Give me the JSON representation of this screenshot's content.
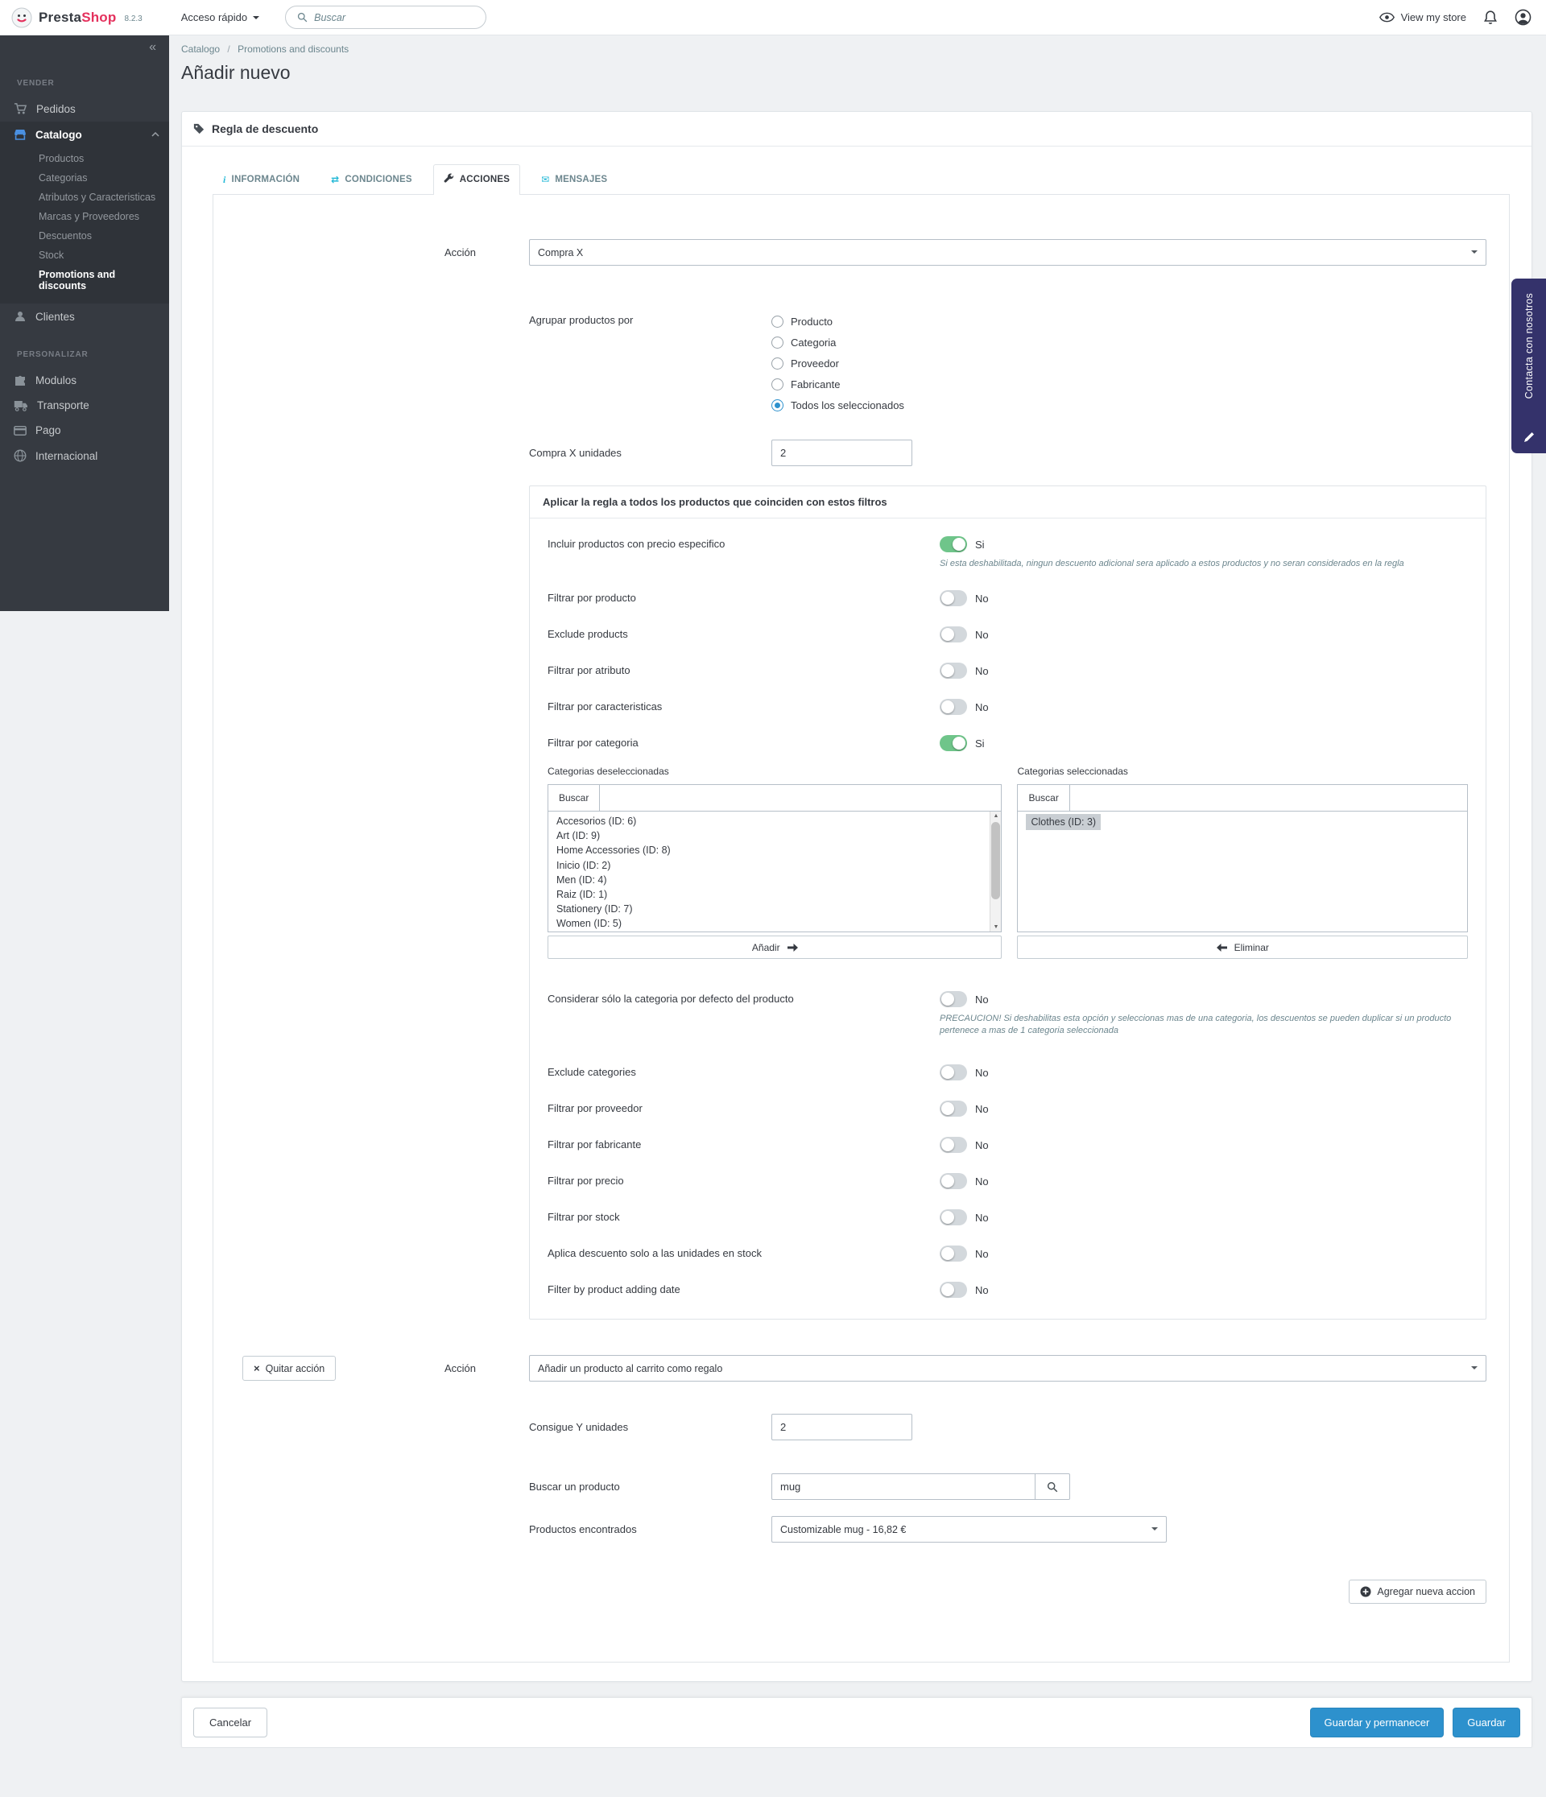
{
  "colors": {
    "accent": "#2d91cd",
    "toggle_on": "#6fc58a",
    "sidebar_bg": "#363a41",
    "brand_red": "#e4315d",
    "contact_bg": "#34326b",
    "tab_icon": "#25b9d7"
  },
  "icons": {
    "collapse": "«",
    "info": "i",
    "shuffle": "⇄",
    "envelope": "✉",
    "close": "×",
    "scroll_up": "▲",
    "scroll_down": "▼"
  },
  "header": {
    "brand_presta": "Presta",
    "brand_shop": "Shop",
    "version": "8.2.3",
    "quick_access": "Acceso rápido",
    "search_placeholder": "Buscar",
    "view_store": "View my store"
  },
  "sidebar": {
    "sell_title": "VENDER",
    "customize_title": "PERSONALIZAR",
    "items": {
      "pedidos": "Pedidos",
      "catalogo": "Catalogo",
      "clientes": "Clientes",
      "modulos": "Modulos",
      "transporte": "Transporte",
      "pago": "Pago",
      "internacional": "Internacional"
    },
    "catalog_children": [
      "Productos",
      "Categorias",
      "Atributos y Caracteristicas",
      "Marcas y Proveedores",
      "Descuentos",
      "Stock",
      "Promotions and discounts"
    ],
    "active_child": "Promotions and discounts"
  },
  "breadcrumb": {
    "part1": "Catalogo",
    "separator": "/",
    "part2": "Promotions and discounts"
  },
  "page": {
    "title": "Añadir nuevo"
  },
  "panel": {
    "title": "Regla de descuento"
  },
  "tabs": [
    {
      "label": "INFORMACIÓN"
    },
    {
      "label": "CONDICIONES"
    },
    {
      "label": "ACCIONES"
    },
    {
      "label": "MENSAJES"
    }
  ],
  "form": {
    "action_label": "Acción",
    "action1_value": "Compra X",
    "group_label": "Agrupar productos por",
    "group_options": [
      "Producto",
      "Categoria",
      "Proveedor",
      "Fabricante",
      "Todos los seleccionados"
    ],
    "group_selected": "Todos los seleccionados",
    "buy_x_label": "Compra X unidades",
    "buy_x_value": "2",
    "filters": {
      "title": "Aplicar la regla a todos los productos que coinciden con estos filtros",
      "rows": [
        {
          "label": "Incluir productos con precio especifico",
          "state": "Si",
          "help": "Si esta deshabilitada, ningun descuento adicional sera aplicado a estos productos y no seran considerados en la regla"
        },
        {
          "label": "Filtrar por producto",
          "state": "No"
        },
        {
          "label": "Exclude products",
          "state": "No"
        },
        {
          "label": "Filtrar por atributo",
          "state": "No"
        },
        {
          "label": "Filtrar por caracteristicas",
          "state": "No"
        },
        {
          "label": "Filtrar por categoria",
          "state": "Si"
        }
      ],
      "categories": {
        "unselected_label": "Categorias deseleccionadas",
        "selected_label": "Categorias seleccionadas",
        "search_label": "Buscar",
        "unselected": [
          "Accesorios (ID: 6)",
          "Art (ID: 9)",
          "Home Accessories (ID: 8)",
          "Inicio (ID: 2)",
          "Men (ID: 4)",
          "Raiz (ID: 1)",
          "Stationery (ID: 7)",
          "Women (ID: 5)"
        ],
        "selected": [
          "Clothes (ID: 3)"
        ],
        "add_button": "Añadir",
        "remove_button": "Eliminar"
      },
      "rows2": [
        {
          "label": "Considerar sólo la categoria por defecto del producto",
          "state": "No",
          "help": "PRECAUCION! Si deshabilitas esta opción y seleccionas mas de una categoria, los descuentos se pueden duplicar si un producto pertenece a mas de 1 categoria seleccionada"
        },
        {
          "label": "Exclude categories",
          "state": "No"
        },
        {
          "label": "Filtrar por proveedor",
          "state": "No"
        },
        {
          "label": "Filtrar por fabricante",
          "state": "No"
        },
        {
          "label": "Filtrar por precio",
          "state": "No"
        },
        {
          "label": "Filtrar por stock",
          "state": "No"
        },
        {
          "label": "Aplica descuento solo a las unidades en stock",
          "state": "No"
        },
        {
          "label": "Filter by product adding date",
          "state": "No"
        }
      ]
    },
    "action2": {
      "remove_button": "Quitar acción",
      "label": "Acción",
      "value": "Añadir un producto al carrito como regalo"
    },
    "get_y_label": "Consigue Y unidades",
    "get_y_value": "2",
    "search_product_label": "Buscar un producto",
    "search_product_value": "mug",
    "found_label": "Productos encontrados",
    "found_value": "Customizable mug - 16,82 €",
    "add_action_button": "Agregar nueva accion"
  },
  "footer": {
    "cancel": "Cancelar",
    "save_stay": "Guardar y permanecer",
    "save": "Guardar"
  },
  "contact": {
    "label": "Contacta con nosotros"
  }
}
